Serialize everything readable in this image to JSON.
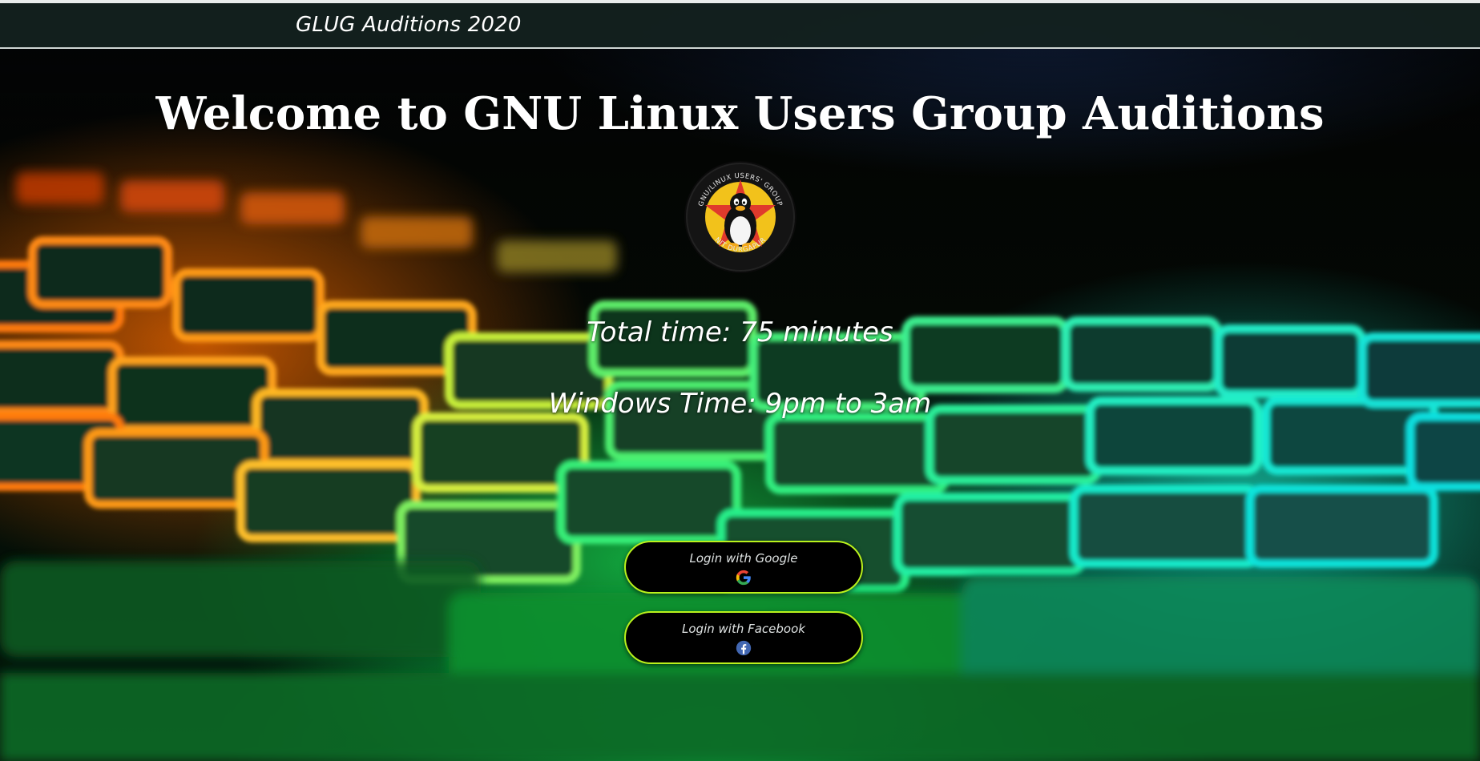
{
  "navbar": {
    "brand": "GLUG Auditions 2020"
  },
  "main": {
    "title": "Welcome to GNU Linux Users Group Auditions",
    "logo": {
      "icon": "glug-tux-logo",
      "top_text": "GNU/LINUX USERS' GROUP",
      "bottom_text": "NIT DURGAPUR"
    },
    "total_time": "Total time: 75 minutes",
    "window_time": "Windows Time: 9pm to 3am"
  },
  "login": {
    "google": {
      "label": "Login with Google",
      "icon": "google-icon"
    },
    "facebook": {
      "label": "Login with Facebook",
      "icon": "facebook-icon"
    }
  },
  "colors": {
    "navbar_bg": "#142220",
    "button_border": "#b9f21c",
    "button_bg": "#000000",
    "logo_yellow": "#f2c21b",
    "logo_star": "#e03a2c",
    "facebook_blue": "#4267b2"
  }
}
